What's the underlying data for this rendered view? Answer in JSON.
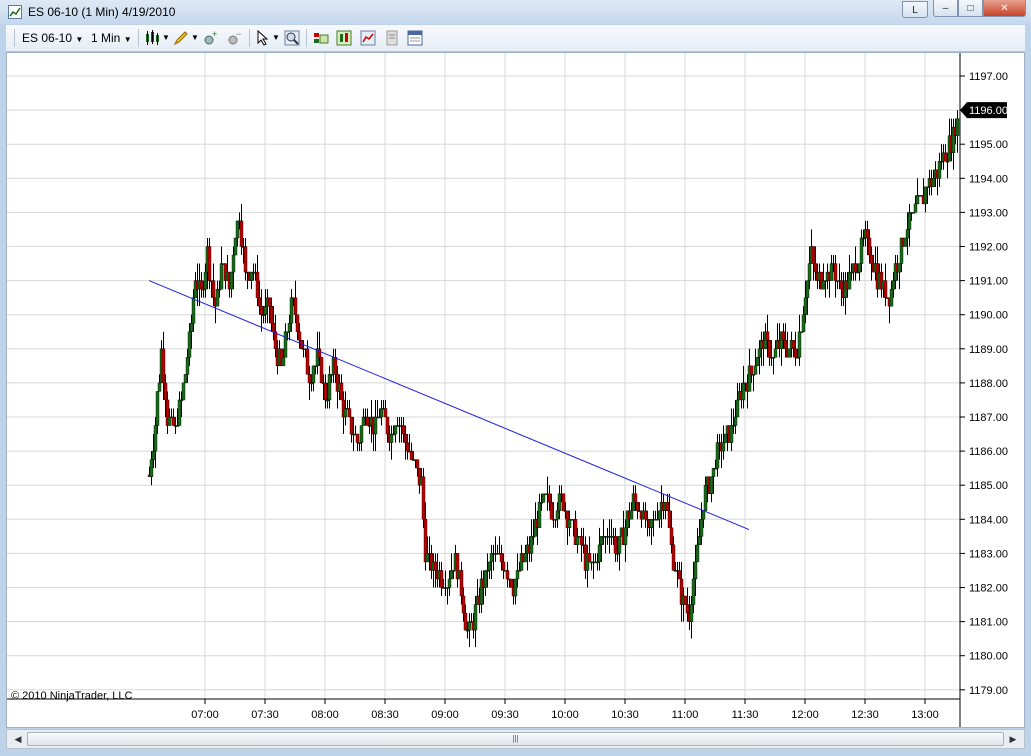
{
  "window": {
    "title": "ES 06-10 (1 Min)  4/19/2010",
    "buttons": {
      "layout": "L",
      "minimize": "–",
      "maximize": "□",
      "close": "✕"
    }
  },
  "toolbar": {
    "instrument": "ES 06-10",
    "interval": "1 Min",
    "icons": [
      "candlestick-icon",
      "pencil-icon",
      "zoom-plus-icon",
      "zoom-minus-icon",
      "cursor-icon",
      "magnifier-icon",
      "indicators-icon",
      "strategies-icon",
      "chart-style-icon",
      "properties-icon",
      "data-box-icon"
    ]
  },
  "copyright": "© 2010 NinjaTrader, LLC",
  "colors": {
    "up": "#1a6b1a",
    "down": "#c00000",
    "trendline": "#2020e0",
    "grid": "#d8d8d8",
    "price_marker": "#000000"
  },
  "chart_data": {
    "type": "candlestick",
    "instrument": "ES 06-10",
    "interval": "1 Min",
    "date": "4/19/2010",
    "x_ticks": [
      "07:00",
      "07:30",
      "08:00",
      "08:30",
      "09:00",
      "09:30",
      "10:00",
      "10:30",
      "11:00",
      "11:30",
      "12:00",
      "12:30",
      "13:00"
    ],
    "y_ticks": [
      "1197.00",
      "1196.00",
      "1195.00",
      "1194.00",
      "1193.00",
      "1192.00",
      "1191.00",
      "1190.00",
      "1189.00",
      "1188.00",
      "1187.00",
      "1186.00",
      "1185.00",
      "1184.00",
      "1183.00",
      "1182.00",
      "1181.00",
      "1180.00",
      "1179.00"
    ],
    "ylim": [
      1178.6,
      1197.5
    ],
    "xlim_minutes": [
      "06:22",
      "13:55"
    ],
    "last_price": "1196.00",
    "grid": true,
    "close_path": [
      {
        "t": "06:32",
        "p": 1185.3
      },
      {
        "t": "06:35",
        "p": 1186.8
      },
      {
        "t": "06:38",
        "p": 1189.0
      },
      {
        "t": "06:41",
        "p": 1187.0
      },
      {
        "t": "06:45",
        "p": 1186.6
      },
      {
        "t": "06:48",
        "p": 1187.5
      },
      {
        "t": "06:52",
        "p": 1189.2
      },
      {
        "t": "06:55",
        "p": 1191.2
      },
      {
        "t": "06:58",
        "p": 1190.5
      },
      {
        "t": "07:01",
        "p": 1191.8
      },
      {
        "t": "07:05",
        "p": 1190.2
      },
      {
        "t": "07:08",
        "p": 1191.5
      },
      {
        "t": "07:12",
        "p": 1190.8
      },
      {
        "t": "07:15",
        "p": 1192.4
      },
      {
        "t": "07:17",
        "p": 1192.9
      },
      {
        "t": "07:20",
        "p": 1191.2
      },
      {
        "t": "07:24",
        "p": 1191.4
      },
      {
        "t": "07:28",
        "p": 1189.9
      },
      {
        "t": "07:32",
        "p": 1190.2
      },
      {
        "t": "07:35",
        "p": 1189.0
      },
      {
        "t": "07:38",
        "p": 1188.4
      },
      {
        "t": "07:41",
        "p": 1189.6
      },
      {
        "t": "07:44",
        "p": 1190.4
      },
      {
        "t": "07:48",
        "p": 1189.2
      },
      {
        "t": "07:52",
        "p": 1188.3
      },
      {
        "t": "07:56",
        "p": 1188.7
      },
      {
        "t": "08:00",
        "p": 1187.6
      },
      {
        "t": "08:04",
        "p": 1188.5
      },
      {
        "t": "08:08",
        "p": 1187.5
      },
      {
        "t": "08:12",
        "p": 1186.8
      },
      {
        "t": "08:16",
        "p": 1186.2
      },
      {
        "t": "08:20",
        "p": 1187.3
      },
      {
        "t": "08:24",
        "p": 1186.7
      },
      {
        "t": "08:28",
        "p": 1187.2
      },
      {
        "t": "08:32",
        "p": 1186.4
      },
      {
        "t": "08:36",
        "p": 1187.1
      },
      {
        "t": "08:40",
        "p": 1186.3
      },
      {
        "t": "08:44",
        "p": 1185.7
      },
      {
        "t": "08:48",
        "p": 1185.1
      },
      {
        "t": "08:50",
        "p": 1183.1
      },
      {
        "t": "08:53",
        "p": 1182.6
      },
      {
        "t": "08:57",
        "p": 1182.4
      },
      {
        "t": "09:01",
        "p": 1182.2
      },
      {
        "t": "09:05",
        "p": 1182.8
      },
      {
        "t": "09:08",
        "p": 1182.0
      },
      {
        "t": "09:11",
        "p": 1180.6
      },
      {
        "t": "09:14",
        "p": 1181.0
      },
      {
        "t": "09:18",
        "p": 1182.0
      },
      {
        "t": "09:22",
        "p": 1182.7
      },
      {
        "t": "09:26",
        "p": 1183.0
      },
      {
        "t": "09:30",
        "p": 1182.7
      },
      {
        "t": "09:34",
        "p": 1182.1
      },
      {
        "t": "09:38",
        "p": 1182.7
      },
      {
        "t": "09:42",
        "p": 1183.2
      },
      {
        "t": "09:46",
        "p": 1184.1
      },
      {
        "t": "09:50",
        "p": 1184.5
      },
      {
        "t": "09:54",
        "p": 1184.3
      },
      {
        "t": "09:58",
        "p": 1184.6
      },
      {
        "t": "10:02",
        "p": 1184.0
      },
      {
        "t": "10:06",
        "p": 1183.5
      },
      {
        "t": "10:10",
        "p": 1182.8
      },
      {
        "t": "10:14",
        "p": 1182.6
      },
      {
        "t": "10:18",
        "p": 1183.3
      },
      {
        "t": "10:22",
        "p": 1183.7
      },
      {
        "t": "10:26",
        "p": 1183.0
      },
      {
        "t": "10:30",
        "p": 1183.8
      },
      {
        "t": "10:34",
        "p": 1184.5
      },
      {
        "t": "10:38",
        "p": 1184.2
      },
      {
        "t": "10:42",
        "p": 1183.6
      },
      {
        "t": "10:46",
        "p": 1184.3
      },
      {
        "t": "10:50",
        "p": 1184.6
      },
      {
        "t": "10:53",
        "p": 1183.2
      },
      {
        "t": "10:56",
        "p": 1182.3
      },
      {
        "t": "10:59",
        "p": 1181.6
      },
      {
        "t": "11:02",
        "p": 1181.3
      },
      {
        "t": "11:06",
        "p": 1183.0
      },
      {
        "t": "11:09",
        "p": 1184.6
      },
      {
        "t": "11:12",
        "p": 1185.0
      },
      {
        "t": "11:16",
        "p": 1186.0
      },
      {
        "t": "11:20",
        "p": 1186.3
      },
      {
        "t": "11:24",
        "p": 1186.8
      },
      {
        "t": "11:28",
        "p": 1187.8
      },
      {
        "t": "11:32",
        "p": 1188.2
      },
      {
        "t": "11:36",
        "p": 1188.9
      },
      {
        "t": "11:40",
        "p": 1189.2
      },
      {
        "t": "11:44",
        "p": 1188.7
      },
      {
        "t": "11:48",
        "p": 1189.3
      },
      {
        "t": "11:52",
        "p": 1188.9
      },
      {
        "t": "11:56",
        "p": 1189.1
      },
      {
        "t": "12:00",
        "p": 1190.6
      },
      {
        "t": "12:03",
        "p": 1191.8
      },
      {
        "t": "12:06",
        "p": 1191.0
      },
      {
        "t": "12:10",
        "p": 1191.2
      },
      {
        "t": "12:14",
        "p": 1191.4
      },
      {
        "t": "12:18",
        "p": 1190.8
      },
      {
        "t": "12:22",
        "p": 1191.0
      },
      {
        "t": "12:26",
        "p": 1191.6
      },
      {
        "t": "12:30",
        "p": 1192.3
      },
      {
        "t": "12:34",
        "p": 1191.5
      },
      {
        "t": "12:38",
        "p": 1190.8
      },
      {
        "t": "12:42",
        "p": 1190.6
      },
      {
        "t": "12:46",
        "p": 1191.6
      },
      {
        "t": "12:50",
        "p": 1192.4
      },
      {
        "t": "12:54",
        "p": 1192.9
      },
      {
        "t": "12:58",
        "p": 1193.4
      },
      {
        "t": "13:02",
        "p": 1193.9
      },
      {
        "t": "13:06",
        "p": 1194.2
      },
      {
        "t": "13:10",
        "p": 1194.8
      },
      {
        "t": "13:14",
        "p": 1195.2
      },
      {
        "t": "13:17",
        "p": 1196.0
      }
    ],
    "trendline": [
      {
        "t": "06:32",
        "p": 1191.0
      },
      {
        "t": "11:32",
        "p": 1183.7
      }
    ]
  }
}
